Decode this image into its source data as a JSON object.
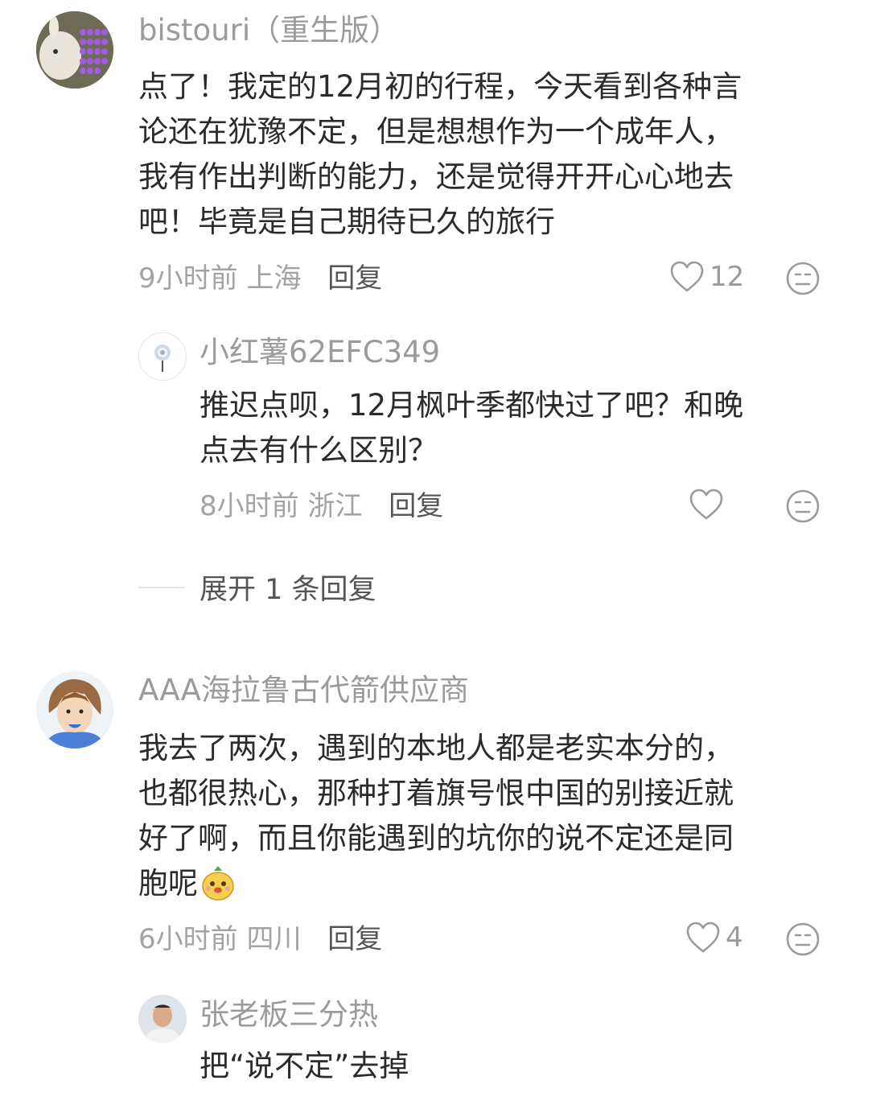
{
  "comments": [
    {
      "user": "bistouri（重生版）",
      "lines": [
        "点了！我定的12月初的行程，今天看到各种言",
        "论还在犹豫不定，但是想想作为一个成年人，",
        "我有作出判断的能力，还是觉得开开心心地去",
        "吧！毕竟是自己期待已久的旅行"
      ],
      "time": "9小时前",
      "location": "上海",
      "reply_label": "回复",
      "likes": "12",
      "replies": [
        {
          "user": "小红薯62EFC349",
          "lines": [
            "推迟点呗，12月枫叶季都快过了吧？和晚",
            "点去有什么区别？"
          ],
          "time": "8小时前",
          "location": "浙江",
          "reply_label": "回复",
          "likes": ""
        }
      ],
      "expand_label": "展开 1 条回复"
    },
    {
      "user": "AAA海拉鲁古代箭供应商",
      "lines": [
        "我去了两次，遇到的本地人都是老实本分的，",
        "也都很热心，那种打着旗号恨中国的别接近就",
        "好了啊，而且你能遇到的坑你的说不定还是同",
        "胞呢"
      ],
      "time": "6小时前",
      "location": "四川",
      "reply_label": "回复",
      "likes": "4",
      "replies": [
        {
          "user": "张老板三分热",
          "lines": [
            "把“说不定”去掉"
          ]
        }
      ]
    }
  ],
  "icons": {
    "like": "heart-outline-icon",
    "dislike": "meh-face-icon",
    "inline_emoji": "smiling-pineapple-emoji"
  },
  "colors": {
    "name": "#9b9b9b",
    "text": "#2b2b2b",
    "meta": "#a3a3a3",
    "reply_action": "#555555"
  }
}
